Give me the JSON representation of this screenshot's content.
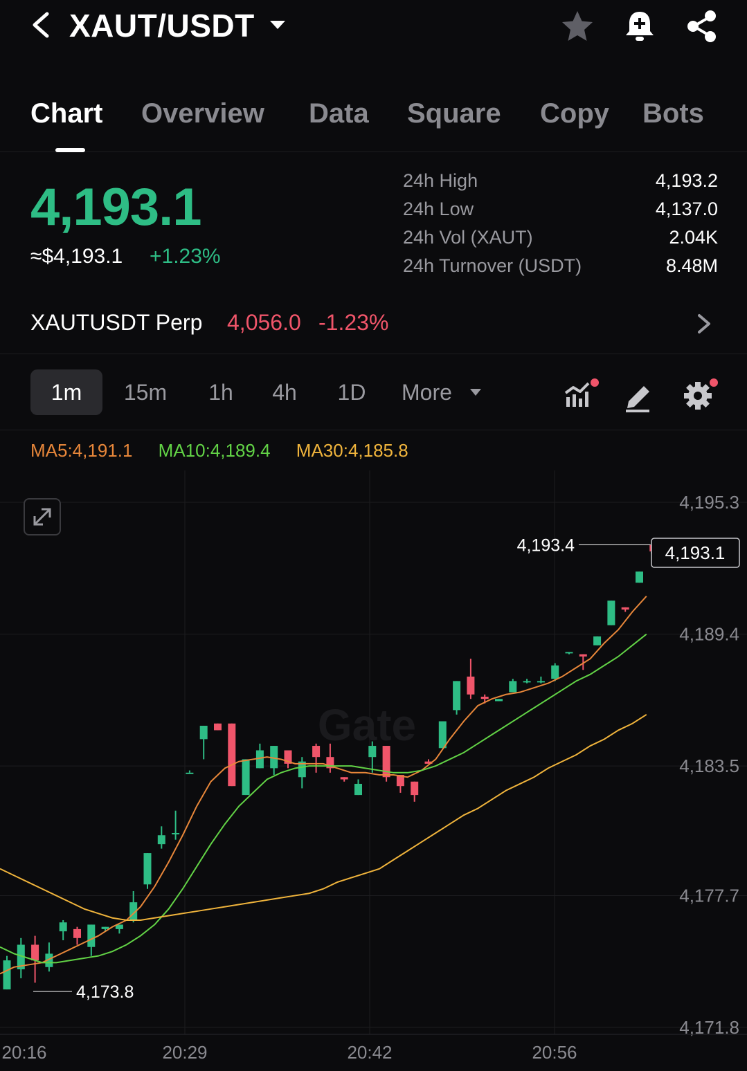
{
  "colors": {
    "background": "#0b0b0d",
    "up": "#2ebd85",
    "down": "#f0556a",
    "ma5": "#e8873a",
    "ma10": "#62d346",
    "ma30": "#f0b43c",
    "muted": "#9a9aa0",
    "grid": "#1c1c1f"
  },
  "header": {
    "pair": "XAUT/USDT",
    "icons": [
      "back-icon",
      "caret-down-icon",
      "star-icon",
      "bell-plus-icon",
      "share-icon"
    ]
  },
  "tabs": [
    "Chart",
    "Overview",
    "Data",
    "Square",
    "Copy",
    "Bots"
  ],
  "active_tab": "Chart",
  "ticker": {
    "last_price": "4,193.1",
    "fiat_price": "≈$4,193.1",
    "change_pct": "+1.23%",
    "stats": [
      {
        "label": "24h High",
        "value": "4,193.2"
      },
      {
        "label": "24h Low",
        "value": "4,137.0"
      },
      {
        "label": "24h Vol (XAUT)",
        "value": "2.04K"
      },
      {
        "label": "24h Turnover (USDT)",
        "value": "8.48M"
      }
    ]
  },
  "perp": {
    "name": "XAUTUSDT Perp",
    "price": "4,056.0",
    "change": "-1.23%"
  },
  "timeframes": [
    "1m",
    "15m",
    "1h",
    "4h",
    "1D",
    "More"
  ],
  "active_timeframe": "1m",
  "tools": [
    "indicators-icon",
    "draw-pen-icon",
    "settings-gear-icon"
  ],
  "ma": {
    "ma5": "MA5:4,191.1",
    "ma10": "MA10:4,189.4",
    "ma30": "MA30:4,185.8"
  },
  "watermark": "Gate",
  "chart_data": {
    "type": "candlestick",
    "interval": "1m",
    "y_ticks": [
      "4,195.3",
      "4,189.4",
      "4,183.5",
      "4,177.7",
      "4,171.8"
    ],
    "x_ticks": [
      "20:16",
      "20:29",
      "20:42",
      "20:56"
    ],
    "ylim": [
      4171.8,
      4195.3
    ],
    "current_price": "4,193.1",
    "high_label": "4,193.4",
    "low_label": "4,173.8",
    "candles": [
      {
        "o": 4173.5,
        "h": 4175.0,
        "c": 4174.8,
        "l": 4173.5
      },
      {
        "o": 4174.4,
        "h": 4175.8,
        "c": 4175.5,
        "l": 4174.0
      },
      {
        "o": 4175.5,
        "h": 4175.9,
        "c": 4174.8,
        "l": 4173.8
      },
      {
        "o": 4174.5,
        "h": 4175.6,
        "c": 4175.1,
        "l": 4174.3
      },
      {
        "o": 4176.1,
        "h": 4176.6,
        "c": 4176.5,
        "l": 4175.7
      },
      {
        "o": 4176.2,
        "h": 4176.3,
        "c": 4175.8,
        "l": 4175.5
      },
      {
        "o": 4175.4,
        "h": 4176.4,
        "c": 4176.4,
        "l": 4175.0
      },
      {
        "o": 4176.2,
        "h": 4176.3,
        "c": 4176.3,
        "l": 4176.1
      },
      {
        "o": 4176.2,
        "h": 4176.4,
        "c": 4176.4,
        "l": 4176.0
      },
      {
        "o": 4176.6,
        "h": 4177.9,
        "c": 4177.4,
        "l": 4176.5
      },
      {
        "o": 4178.2,
        "h": 4179.4,
        "c": 4179.6,
        "l": 4178.0
      },
      {
        "o": 4180.0,
        "h": 4180.8,
        "c": 4180.4,
        "l": 4179.8
      },
      {
        "o": 4180.5,
        "h": 4181.5,
        "c": 4180.5,
        "l": 4180.2
      },
      {
        "o": 4183.2,
        "h": 4183.3,
        "c": 4183.2,
        "l": 4183.2
      },
      {
        "o": 4184.7,
        "h": 4185.1,
        "c": 4185.3,
        "l": 4183.8
      },
      {
        "o": 4185.4,
        "h": 4185.4,
        "c": 4185.1,
        "l": 4185.1
      },
      {
        "o": 4185.4,
        "h": 4185.4,
        "c": 4182.6,
        "l": 4182.6
      },
      {
        "o": 4182.2,
        "h": 4183.8,
        "c": 4183.8,
        "l": 4182.2
      },
      {
        "o": 4183.4,
        "h": 4184.5,
        "c": 4184.2,
        "l": 4183.4
      },
      {
        "o": 4183.4,
        "h": 4184.4,
        "c": 4184.4,
        "l": 4183.1
      },
      {
        "o": 4184.2,
        "h": 4184.2,
        "c": 4183.6,
        "l": 4183.4
      },
      {
        "o": 4183.0,
        "h": 4183.9,
        "c": 4183.7,
        "l": 4182.5
      },
      {
        "o": 4184.4,
        "h": 4184.5,
        "c": 4183.9,
        "l": 4183.2
      },
      {
        "o": 4183.9,
        "h": 4184.5,
        "c": 4183.4,
        "l": 4183.2
      },
      {
        "o": 4183.0,
        "h": 4183.0,
        "c": 4182.9,
        "l": 4182.8
      },
      {
        "o": 4182.2,
        "h": 4182.9,
        "c": 4182.7,
        "l": 4182.2
      },
      {
        "o": 4183.9,
        "h": 4184.6,
        "c": 4184.4,
        "l": 4183.2
      },
      {
        "o": 4184.4,
        "h": 4184.4,
        "c": 4183.0,
        "l": 4182.8
      },
      {
        "o": 4183.1,
        "h": 4183.1,
        "c": 4182.6,
        "l": 4182.3
      },
      {
        "o": 4182.8,
        "h": 4182.8,
        "c": 4182.2,
        "l": 4181.9
      },
      {
        "o": 4183.7,
        "h": 4183.8,
        "c": 4183.6,
        "l": 4183.6
      },
      {
        "o": 4184.3,
        "h": 4184.6,
        "c": 4185.5,
        "l": 4184.3
      },
      {
        "o": 4186.0,
        "h": 4186.4,
        "c": 4187.3,
        "l": 4185.8
      },
      {
        "o": 4187.5,
        "h": 4188.3,
        "c": 4186.7,
        "l": 4186.5
      },
      {
        "o": 4186.6,
        "h": 4186.7,
        "c": 4186.5,
        "l": 4186.3
      },
      {
        "o": 4186.4,
        "h": 4186.5,
        "c": 4186.5,
        "l": 4186.4
      },
      {
        "o": 4186.8,
        "h": 4187.4,
        "c": 4187.3,
        "l": 4186.8
      },
      {
        "o": 4187.3,
        "h": 4187.4,
        "c": 4187.3,
        "l": 4187.2
      },
      {
        "o": 4187.3,
        "h": 4187.5,
        "c": 4187.3,
        "l": 4187.2
      },
      {
        "o": 4187.4,
        "h": 4188.1,
        "c": 4188.0,
        "l": 4187.3
      },
      {
        "o": 4188.6,
        "h": 4188.6,
        "c": 4188.6,
        "l": 4188.5
      },
      {
        "o": 4188.5,
        "h": 4188.5,
        "c": 4188.4,
        "l": 4187.8
      },
      {
        "o": 4188.9,
        "h": 4189.3,
        "c": 4189.3,
        "l": 4188.9
      },
      {
        "o": 4189.8,
        "h": 4190.9,
        "c": 4190.9,
        "l": 4189.8
      },
      {
        "o": 4190.6,
        "h": 4190.6,
        "c": 4190.5,
        "l": 4190.4
      },
      {
        "o": 4191.7,
        "h": 4191.9,
        "c": 4192.2,
        "l": 4191.7
      },
      {
        "o": 4193.4,
        "h": 4193.4,
        "c": 4193.1,
        "l": 4193.0
      }
    ],
    "series": [
      {
        "name": "MA5",
        "values": [
          4174.2,
          4174.5,
          4174.6,
          4174.7,
          4175.0,
          4175.3,
          4175.6,
          4175.9,
          4176.3,
          4176.6,
          4177.2,
          4178.1,
          4179.2,
          4180.4,
          4181.7,
          4182.8,
          4183.4,
          4183.7,
          4183.8,
          4183.9,
          4183.8,
          4183.6,
          4183.6,
          4183.6,
          4183.4,
          4183.2,
          4183.2,
          4183.1,
          4183.1,
          4183.0,
          4183.3,
          4183.8,
          4184.7,
          4185.5,
          4186.2,
          4186.5,
          4186.7,
          4186.8,
          4187.0,
          4187.2,
          4187.5,
          4187.9,
          4188.3,
          4189.0,
          4189.6,
          4190.4,
          4191.1
        ]
      },
      {
        "name": "MA10",
        "values": [
          4175.4,
          4175.1,
          4174.9,
          4174.7,
          4174.7,
          4174.8,
          4174.9,
          4175.0,
          4175.2,
          4175.5,
          4175.9,
          4176.4,
          4177.1,
          4178.0,
          4179.0,
          4180.0,
          4180.9,
          4181.7,
          4182.3,
          4182.9,
          4183.2,
          4183.4,
          4183.5,
          4183.5,
          4183.5,
          4183.5,
          4183.4,
          4183.3,
          4183.2,
          4183.2,
          4183.3,
          4183.5,
          4183.8,
          4184.1,
          4184.5,
          4184.9,
          4185.3,
          4185.7,
          4186.1,
          4186.5,
          4186.9,
          4187.3,
          4187.6,
          4188.0,
          4188.4,
          4188.9,
          4189.4
        ]
      },
      {
        "name": "MA30",
        "values": [
          4178.9,
          4178.6,
          4178.3,
          4178.0,
          4177.7,
          4177.4,
          4177.1,
          4176.9,
          4176.7,
          4176.6,
          4176.6,
          4176.7,
          4176.8,
          4176.9,
          4177.0,
          4177.1,
          4177.2,
          4177.3,
          4177.4,
          4177.5,
          4177.6,
          4177.7,
          4177.8,
          4178.0,
          4178.3,
          4178.5,
          4178.7,
          4178.9,
          4179.3,
          4179.7,
          4180.1,
          4180.5,
          4180.9,
          4181.3,
          4181.6,
          4182.0,
          4182.4,
          4182.7,
          4183.0,
          4183.4,
          4183.7,
          4184.0,
          4184.4,
          4184.7,
          4185.1,
          4185.4,
          4185.8
        ]
      }
    ]
  }
}
